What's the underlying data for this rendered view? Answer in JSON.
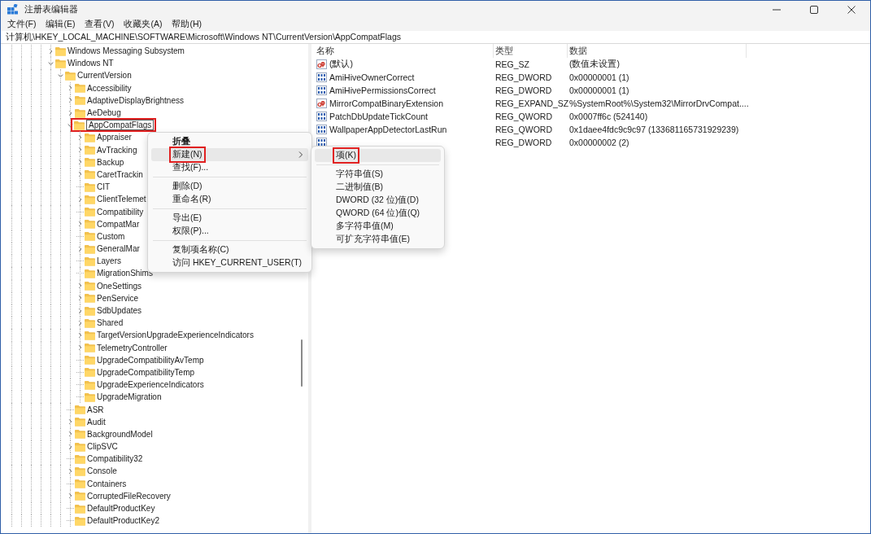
{
  "window": {
    "title": "注册表编辑器"
  },
  "menu_bar": [
    "文件(F)",
    "编辑(E)",
    "查看(V)",
    "收藏夹(A)",
    "帮助(H)"
  ],
  "address": "计算机\\HKEY_LOCAL_MACHINE\\SOFTWARE\\Microsoft\\Windows NT\\CurrentVersion\\AppCompatFlags",
  "tree": [
    {
      "name": "Windows Messaging Subsystem",
      "kind": "branch",
      "expanded": false,
      "selected": false
    },
    {
      "name": "Windows NT",
      "kind": "branch",
      "expanded": true,
      "selected": false,
      "children": [
        {
          "name": "CurrentVersion",
          "kind": "branch",
          "expanded": true,
          "selected": false,
          "children": [
            {
              "name": "Accessibility",
              "kind": "branch",
              "expanded": false,
              "selected": false
            },
            {
              "name": "AdaptiveDisplayBrightness",
              "kind": "branch",
              "expanded": false,
              "selected": false
            },
            {
              "name": "AeDebug",
              "kind": "branch",
              "expanded": false,
              "selected": false
            },
            {
              "name": "AppCompatFlags",
              "kind": "branch",
              "expanded": true,
              "selected": true,
              "children": [
                {
                  "name": "Appraiser",
                  "kind": "branch",
                  "expanded": false,
                  "selected": false
                },
                {
                  "name": "AvTracking",
                  "kind": "branch",
                  "expanded": false,
                  "selected": false
                },
                {
                  "name": "Backup",
                  "kind": "branch",
                  "expanded": false,
                  "selected": false
                },
                {
                  "name": "CaretTrackin",
                  "kind": "branch",
                  "expanded": false,
                  "selected": false
                },
                {
                  "name": "CIT",
                  "kind": "leaf",
                  "selected": false
                },
                {
                  "name": "ClientTelemet",
                  "kind": "branch",
                  "expanded": false,
                  "selected": false
                },
                {
                  "name": "Compatibility",
                  "kind": "leaf",
                  "selected": false
                },
                {
                  "name": "CompatMar",
                  "kind": "branch",
                  "expanded": false,
                  "selected": false
                },
                {
                  "name": "Custom",
                  "kind": "leaf",
                  "selected": false
                },
                {
                  "name": "GeneralMar",
                  "kind": "branch",
                  "expanded": false,
                  "selected": false
                },
                {
                  "name": "Layers",
                  "kind": "leaf",
                  "selected": false
                },
                {
                  "name": "MigrationShims",
                  "kind": "leaf",
                  "selected": false
                },
                {
                  "name": "OneSettings",
                  "kind": "branch",
                  "expanded": false,
                  "selected": false
                },
                {
                  "name": "PenService",
                  "kind": "branch",
                  "expanded": false,
                  "selected": false
                },
                {
                  "name": "SdbUpdates",
                  "kind": "branch",
                  "expanded": false,
                  "selected": false
                },
                {
                  "name": "Shared",
                  "kind": "branch",
                  "expanded": false,
                  "selected": false
                },
                {
                  "name": "TargetVersionUpgradeExperienceIndicators",
                  "kind": "branch",
                  "expanded": false,
                  "selected": false
                },
                {
                  "name": "TelemetryController",
                  "kind": "branch",
                  "expanded": false,
                  "selected": false
                },
                {
                  "name": "UpgradeCompatibilityAvTemp",
                  "kind": "leaf",
                  "selected": false
                },
                {
                  "name": "UpgradeCompatibilityTemp",
                  "kind": "leaf",
                  "selected": false
                },
                {
                  "name": "UpgradeExperienceIndicators",
                  "kind": "leaf",
                  "selected": false
                },
                {
                  "name": "UpgradeMigration",
                  "kind": "leaf",
                  "selected": false
                }
              ]
            },
            {
              "name": "ASR",
              "kind": "leaf",
              "selected": false
            },
            {
              "name": "Audit",
              "kind": "branch",
              "expanded": false,
              "selected": false
            },
            {
              "name": "BackgroundModel",
              "kind": "branch",
              "expanded": false,
              "selected": false
            },
            {
              "name": "ClipSVC",
              "kind": "branch",
              "expanded": false,
              "selected": false
            },
            {
              "name": "Compatibility32",
              "kind": "leaf",
              "selected": false
            },
            {
              "name": "Console",
              "kind": "branch",
              "expanded": false,
              "selected": false
            },
            {
              "name": "Containers",
              "kind": "leaf",
              "selected": false
            },
            {
              "name": "CorruptedFileRecovery",
              "kind": "branch",
              "expanded": false,
              "selected": false
            },
            {
              "name": "DefaultProductKey",
              "kind": "leaf",
              "selected": false
            },
            {
              "name": "DefaultProductKey2",
              "kind": "leaf",
              "selected": false
            }
          ]
        }
      ]
    }
  ],
  "values": {
    "columns": [
      "名称",
      "类型",
      "数据"
    ],
    "rows": [
      {
        "kind": "string",
        "name": "(默认)",
        "type": "REG_SZ",
        "data": "(数值未设置)"
      },
      {
        "kind": "binary",
        "name": "AmiHiveOwnerCorrect",
        "type": "REG_DWORD",
        "data": "0x00000001 (1)"
      },
      {
        "kind": "binary",
        "name": "AmiHivePermissionsCorrect",
        "type": "REG_DWORD",
        "data": "0x00000001 (1)"
      },
      {
        "kind": "string",
        "name": "MirrorCompatBinaryExtension",
        "type": "REG_EXPAND_SZ",
        "data": "%SystemRoot%\\System32\\MirrorDrvCompat...."
      },
      {
        "kind": "binary",
        "name": "PatchDbUpdateTickCount",
        "type": "REG_QWORD",
        "data": "0x0007ff6c (524140)"
      },
      {
        "kind": "binary",
        "name": "WallpaperAppDetectorLastRun",
        "type": "REG_QWORD",
        "data": "0x1daee4fdc9c9c97 (133681165731929239)"
      },
      {
        "kind": "binary",
        "type": "REG_DWORD",
        "data": "0x00000002 (2)"
      }
    ]
  },
  "context_menu": [
    {
      "kind": "item",
      "label": "折叠",
      "bold": true,
      "highlighted": false,
      "annotated": false
    },
    {
      "kind": "submenu",
      "label": "新建(N)",
      "bold": false,
      "highlighted": true,
      "annotated": true
    },
    {
      "kind": "item",
      "label": "查找(F)...",
      "bold": false,
      "highlighted": false,
      "annotated": false
    },
    {
      "kind": "separator"
    },
    {
      "kind": "item",
      "label": "删除(D)",
      "bold": false,
      "highlighted": false,
      "annotated": false
    },
    {
      "kind": "item",
      "label": "重命名(R)",
      "bold": false,
      "highlighted": false,
      "annotated": false
    },
    {
      "kind": "separator"
    },
    {
      "kind": "item",
      "label": "导出(E)",
      "bold": false,
      "highlighted": false,
      "annotated": false
    },
    {
      "kind": "item",
      "label": "权限(P)...",
      "bold": false,
      "highlighted": false,
      "annotated": false
    },
    {
      "kind": "separator"
    },
    {
      "kind": "item",
      "label": "复制项名称(C)",
      "bold": false,
      "highlighted": false,
      "annotated": false
    },
    {
      "kind": "item",
      "label": "访问 HKEY_CURRENT_USER(T)",
      "bold": false,
      "highlighted": false,
      "annotated": false
    }
  ],
  "submenu": [
    {
      "kind": "item",
      "label": "项(K)",
      "highlighted": true,
      "annotated": true
    },
    {
      "kind": "separator"
    },
    {
      "kind": "item",
      "label": "字符串值(S)",
      "highlighted": false,
      "annotated": false
    },
    {
      "kind": "item",
      "label": "二进制值(B)",
      "highlighted": false,
      "annotated": false
    },
    {
      "kind": "item",
      "label": "DWORD (32 位)值(D)",
      "highlighted": false,
      "annotated": false
    },
    {
      "kind": "item",
      "label": "QWORD (64 位)值(Q)",
      "highlighted": false,
      "annotated": false
    },
    {
      "kind": "item",
      "label": "多字符串值(M)",
      "highlighted": false,
      "annotated": false
    },
    {
      "kind": "item",
      "label": "可扩充字符串值(E)",
      "highlighted": false,
      "annotated": false
    }
  ]
}
